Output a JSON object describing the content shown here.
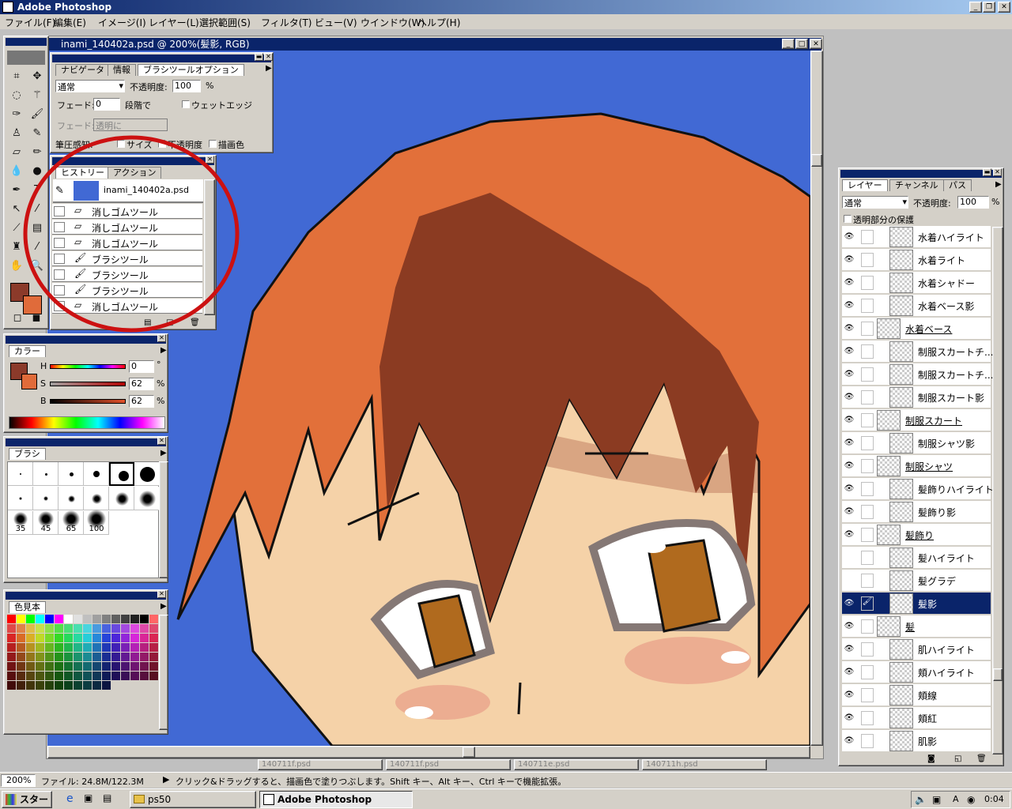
{
  "app": {
    "title": "Adobe Photoshop"
  },
  "menu": [
    "ファイル(F)",
    "編集(E)",
    "イメージ(I)",
    "レイヤー(L)",
    "選択範囲(S)",
    "フィルタ(T)",
    "ビュー(V)",
    "ウインドウ(W)",
    "ヘルプ(H)"
  ],
  "document": {
    "title": "inami_140402a.psd @ 200%(髪影, RGB)"
  },
  "options": {
    "tabs": [
      "ナビゲータ",
      "情報",
      "ブラシツールオプション"
    ],
    "mode": "通常",
    "opacity_label": "不透明度:",
    "opacity": "100",
    "pct": "%",
    "fade_label": "フェード:",
    "fade": "0",
    "steps_label": "段階で",
    "wet_label": "ウェットエッジ",
    "fade2_label": "フェード:",
    "fade2": "透明に",
    "stylus_label": "筆圧感知:",
    "size_label": "サイズ",
    "opac_label": "不透明度",
    "color_label": "描画色"
  },
  "history": {
    "tabs": [
      "ヒストリー",
      "アクション"
    ],
    "snapshot": "inami_140402a.psd",
    "items": [
      {
        "icon": "eraser-icon",
        "label": "消しゴムツール"
      },
      {
        "icon": "eraser-icon",
        "label": "消しゴムツール"
      },
      {
        "icon": "eraser-icon",
        "label": "消しゴムツール"
      },
      {
        "icon": "brush-icon",
        "label": "ブラシツール"
      },
      {
        "icon": "brush-icon",
        "label": "ブラシツール"
      },
      {
        "icon": "brush-icon",
        "label": "ブラシツール"
      },
      {
        "icon": "eraser-icon",
        "label": "消しゴムツール"
      }
    ]
  },
  "color": {
    "tab": "カラー",
    "h_label": "H",
    "s_label": "S",
    "b_label": "B",
    "h": "0",
    "s": "62",
    "b": "62",
    "deg": "°",
    "pct": "%",
    "fg": "#8b3a2a",
    "bg": "#e06b3a"
  },
  "brushes": {
    "tab": "ブラシ",
    "labels": [
      "35",
      "45",
      "65",
      "100"
    ]
  },
  "swatches": {
    "tab": "色見本"
  },
  "layers": {
    "tabs": [
      "レイヤー",
      "チャンネル",
      "パス"
    ],
    "mode": "通常",
    "opacity_label": "不透明度:",
    "opacity": "100",
    "pct": "%",
    "preserve_label": "透明部分の保護",
    "items": [
      {
        "name": "水着ハイライト",
        "eye": "👁",
        "indent": true,
        "sel": false,
        "link": ""
      },
      {
        "name": "水着ライト",
        "eye": "👁",
        "indent": true,
        "sel": false,
        "link": ""
      },
      {
        "name": "水着シャドー",
        "eye": "👁",
        "indent": true,
        "sel": false,
        "link": ""
      },
      {
        "name": "水着ベース影",
        "eye": "👁",
        "indent": true,
        "sel": false,
        "link": ""
      },
      {
        "name": "水着ベース",
        "eye": "👁",
        "indent": false,
        "sel": false,
        "link": ""
      },
      {
        "name": "制服スカートチ...",
        "eye": "👁",
        "indent": true,
        "sel": false,
        "link": ""
      },
      {
        "name": "制服スカートチ...",
        "eye": "👁",
        "indent": true,
        "sel": false,
        "link": ""
      },
      {
        "name": "制服スカート影",
        "eye": "👁",
        "indent": true,
        "sel": false,
        "link": ""
      },
      {
        "name": "制服スカート",
        "eye": "👁",
        "indent": false,
        "sel": false,
        "link": ""
      },
      {
        "name": "制服シャツ影",
        "eye": "👁",
        "indent": true,
        "sel": false,
        "link": ""
      },
      {
        "name": "制服シャツ",
        "eye": "👁",
        "indent": false,
        "sel": false,
        "link": ""
      },
      {
        "name": "髪飾りハイライト",
        "eye": "👁",
        "indent": true,
        "sel": false,
        "link": ""
      },
      {
        "name": "髪飾り影",
        "eye": "👁",
        "indent": true,
        "sel": false,
        "link": ""
      },
      {
        "name": "髪飾り",
        "eye": "👁",
        "indent": false,
        "sel": false,
        "link": ""
      },
      {
        "name": "髪ハイライト",
        "eye": "",
        "indent": true,
        "sel": false,
        "link": ""
      },
      {
        "name": "髪グラデ",
        "eye": "",
        "indent": true,
        "sel": false,
        "link": ""
      },
      {
        "name": "髪影",
        "eye": "👁",
        "indent": true,
        "sel": true,
        "link": "🖌"
      },
      {
        "name": "髪",
        "eye": "👁",
        "indent": false,
        "sel": false,
        "link": ""
      },
      {
        "name": "肌ハイライト",
        "eye": "👁",
        "indent": true,
        "sel": false,
        "link": ""
      },
      {
        "name": "頬ハイライト",
        "eye": "👁",
        "indent": true,
        "sel": false,
        "link": ""
      },
      {
        "name": "頬線",
        "eye": "👁",
        "indent": true,
        "sel": false,
        "link": ""
      },
      {
        "name": "頬紅",
        "eye": "👁",
        "indent": true,
        "sel": false,
        "link": ""
      },
      {
        "name": "肌影",
        "eye": "👁",
        "indent": true,
        "sel": false,
        "link": ""
      }
    ]
  },
  "status": {
    "zoom": "200%",
    "file": "ファイル: 24.8M/122.3M",
    "hint": "クリック&ドラッグすると、描画色で塗りつぶします。Shift キー、Alt キー、Ctrl キーで機能拡張。"
  },
  "minimized": [
    "140711f.psd",
    "140711f.psd",
    "140711e.psd",
    "140711h.psd"
  ],
  "taskbar": {
    "start": "スタート",
    "folder": "ps50",
    "app": "Adobe Photoshop",
    "time": "0:04",
    "ime": "A"
  },
  "colors": {
    "canvas_bg": "#4169d4",
    "hair": "#e2703a",
    "hair_shadow": "#8b3b22",
    "skin": "#f5d2a8",
    "skin_shadow": "#d9a582",
    "iris": "#b06a1e",
    "annot": "#cc1111"
  }
}
